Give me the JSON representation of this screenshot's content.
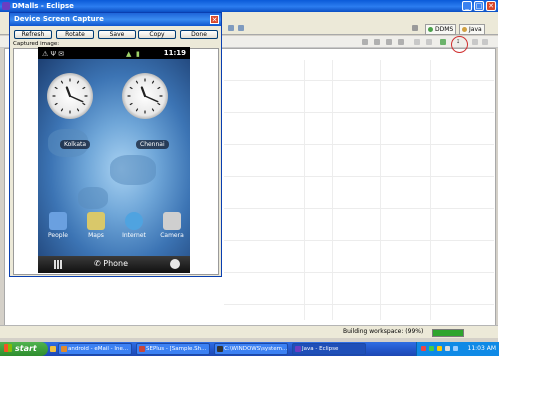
{
  "eclipse": {
    "title": "DMalls - Eclipse",
    "perspectives": [
      {
        "label": "DDMS",
        "color": "#4aa04a"
      },
      {
        "label": "Java",
        "color": "#d0a040"
      }
    ],
    "status_text": "Building workspace: (99%)",
    "progress_fraction": 0.99,
    "export_icon_text": "↧"
  },
  "dialog": {
    "title": "Device Screen Capture",
    "close": "✕",
    "buttons": [
      "Refresh",
      "Rotate",
      "Save",
      "Copy",
      "Done"
    ],
    "capture_label": "Captured image:"
  },
  "phone": {
    "time": "11:19",
    "status_icons_left": "⚠ Ψ ✉",
    "clocks": [
      {
        "city": "Kolkata",
        "hour": 11,
        "minute": 19
      },
      {
        "city": "Chennai",
        "hour": 11,
        "minute": 19
      }
    ],
    "apps": [
      {
        "label": "People",
        "color": "#6aa0e0"
      },
      {
        "label": "Maps",
        "color": "#d9c86a"
      },
      {
        "label": "Internet",
        "color": "#4fa3e0"
      },
      {
        "label": "Camera",
        "color": "#cfcfcf"
      }
    ],
    "dock_label": "Phone"
  },
  "taskbar": {
    "start": "start",
    "tasks": [
      {
        "label": "android - eMail - Ine...",
        "color": "#e08a2c"
      },
      {
        "label": "SEPlus - [Sample.Sh...",
        "color": "#c8463a"
      },
      {
        "label": "C:\\WINDOWS\\system...",
        "color": "#333333"
      },
      {
        "label": "Java - Eclipse",
        "color": "#6a3ec2"
      }
    ],
    "clock": "11:03 AM"
  }
}
